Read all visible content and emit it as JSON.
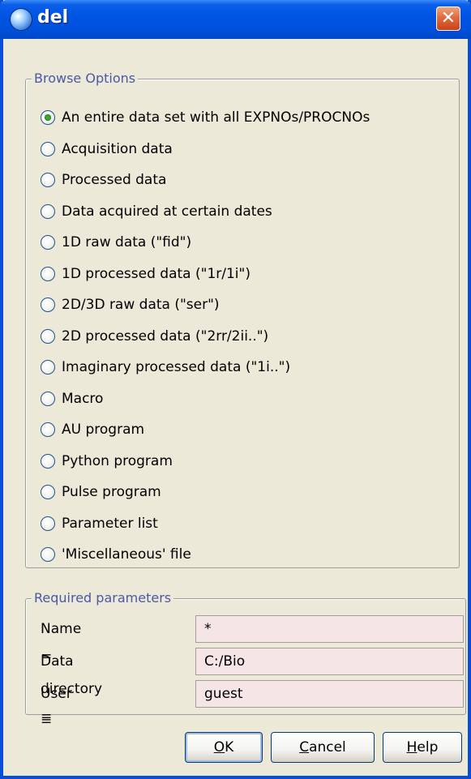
{
  "window": {
    "title": "del",
    "close_symbol": "✕"
  },
  "browse": {
    "group_title": "Browse Options",
    "options": [
      {
        "label": "An entire data set with all EXPNOs/PROCNOs",
        "checked": true
      },
      {
        "label": "Acquisition data",
        "checked": false
      },
      {
        "label": "Processed data",
        "checked": false
      },
      {
        "label": "Data acquired at certain dates",
        "checked": false
      },
      {
        "label": "1D raw data (\"fid\")",
        "checked": false
      },
      {
        "label": "1D processed data (\"1r/1i\")",
        "checked": false
      },
      {
        "label": "2D/3D raw data (\"ser\")",
        "checked": false
      },
      {
        "label": "2D processed data (\"2rr/2ii..\")",
        "checked": false
      },
      {
        "label": "Imaginary processed data (\"1i..\")",
        "checked": false
      },
      {
        "label": "Macro",
        "checked": false
      },
      {
        "label": "AU program",
        "checked": false
      },
      {
        "label": "Python program",
        "checked": false
      },
      {
        "label": "Pulse program",
        "checked": false
      },
      {
        "label": "Parameter list",
        "checked": false
      },
      {
        "label": "'Miscellaneous' file",
        "checked": false
      }
    ]
  },
  "params": {
    "group_title": "Required parameters",
    "rows": [
      {
        "label": "Name =",
        "value": "*"
      },
      {
        "label": "Data directory =",
        "value": "C:/Bio"
      },
      {
        "label": "User =",
        "value": "guest"
      }
    ]
  },
  "buttons": {
    "ok": {
      "mnemonic": "O",
      "rest": "K"
    },
    "cancel": {
      "mnemonic": "C",
      "rest": "ancel"
    },
    "help": {
      "mnemonic": "H",
      "rest": "elp"
    }
  }
}
